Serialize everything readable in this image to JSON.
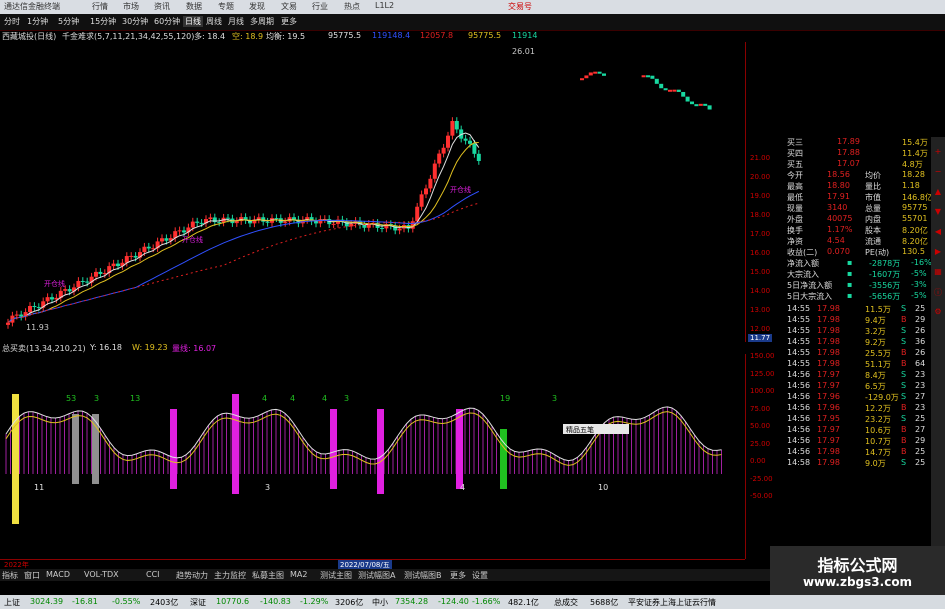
{
  "titlebar": {
    "app_title": "通达信金融终端",
    "menus": [
      "行情",
      "市场",
      "资讯",
      "数据",
      "专题",
      "发现",
      "文易",
      "行业",
      "热点",
      "L1L2"
    ],
    "right_label": "交易号"
  },
  "toolbar": {
    "tabs": [
      "分时",
      "1分钟",
      "5分钟",
      "15分钟",
      "30分钟",
      "60分钟",
      "日线",
      "周线",
      "月线",
      "多周期",
      "更多"
    ]
  },
  "infobar": {
    "stock": "西藏城投(日线)",
    "indicator": "千金难求(5,7,11,21,34,42,55,120)",
    "duo_label": "多: 18.4",
    "kong_label": "空: 18.9",
    "jun_label": "均衡: 19.5",
    "v1": "95775.5",
    "v2": "119148.4",
    "v3": "12057.8",
    "v4": "95775.5",
    "v5": "11914"
  },
  "price_axis": {
    "ticks": [
      "21.00",
      "20.00",
      "19.00",
      "18.00",
      "17.00",
      "16.00",
      "15.00",
      "14.00",
      "13.00",
      "12.00"
    ],
    "current": "11.77"
  },
  "chart_labels": {
    "high": "26.01",
    "low": "11.93",
    "signal1": "开仓线",
    "signal2": "开仓线",
    "signal3": "开仓线"
  },
  "quote": {
    "rows": [
      {
        "label": "买三",
        "price": "17.89",
        "vol": "15.4万"
      },
      {
        "label": "买四",
        "price": "17.88",
        "vol": "11.4万"
      },
      {
        "label": "买五",
        "price": "17.07",
        "vol": "4.8万"
      },
      {
        "label": "今开",
        "price": "18.56",
        "label2": "均价",
        "val2": "18.28"
      },
      {
        "label": "最高",
        "price": "18.80",
        "label2": "量比",
        "val2": "1.18"
      },
      {
        "label": "最低",
        "price": "17.91",
        "label2": "市值",
        "val2": "146.8亿"
      },
      {
        "label": "现量",
        "price": "3140",
        "label2": "总量",
        "val2": "95775"
      },
      {
        "label": "外盘",
        "price": "40075",
        "label2": "内盘",
        "val2": "55701"
      },
      {
        "label": "换手",
        "price": "1.17%",
        "label2": "股本",
        "val2": "8.20亿"
      },
      {
        "label": "净资",
        "price": "4.54",
        "label2": "流通",
        "val2": "8.20亿"
      },
      {
        "label": "收益(二)",
        "price": "0.070",
        "label2": "PE(动)",
        "val2": "130.5"
      }
    ],
    "flows": [
      {
        "label": "净流入额",
        "val": "-2878万",
        "pct": "-16%"
      },
      {
        "label": "大宗流入",
        "val": "-1607万",
        "pct": "-5%"
      },
      {
        "label": "5日净流入额",
        "val": "-3556万",
        "pct": "-3%"
      },
      {
        "label": "5日大宗流入",
        "val": "-5656万",
        "pct": "-5%"
      }
    ],
    "ticks": [
      {
        "t": "14:55",
        "p": "17.98",
        "v": "11.5万",
        "s": "S",
        "n": "25"
      },
      {
        "t": "14:55",
        "p": "17.98",
        "v": "9.4万",
        "s": "B",
        "n": "29"
      },
      {
        "t": "14:55",
        "p": "17.98",
        "v": "3.2万",
        "s": "S",
        "n": "26"
      },
      {
        "t": "14:55",
        "p": "17.98",
        "v": "9.2万",
        "s": "S",
        "n": "36"
      },
      {
        "t": "14:55",
        "p": "17.98",
        "v": "25.5万",
        "s": "B",
        "n": "26"
      },
      {
        "t": "14:55",
        "p": "17.98",
        "v": "51.1万",
        "s": "B",
        "n": "64"
      },
      {
        "t": "14:56",
        "p": "17.97",
        "v": "8.4万",
        "s": "S",
        "n": "23"
      },
      {
        "t": "14:56",
        "p": "17.97",
        "v": "6.5万",
        "s": "S",
        "n": "23"
      },
      {
        "t": "14:56",
        "p": "17.96",
        "v": "-129.0万",
        "s": "S",
        "n": "27"
      },
      {
        "t": "14:56",
        "p": "17.96",
        "v": "12.2万",
        "s": "B",
        "n": "23"
      },
      {
        "t": "14:56",
        "p": "17.95",
        "v": "23.2万",
        "s": "S",
        "n": "25"
      },
      {
        "t": "14:56",
        "p": "17.97",
        "v": "10.6万",
        "s": "B",
        "n": "27"
      },
      {
        "t": "14:56",
        "p": "17.97",
        "v": "10.7万",
        "s": "B",
        "n": "29"
      },
      {
        "t": "14:56",
        "p": "17.98",
        "v": "14.7万",
        "s": "B",
        "n": "25"
      },
      {
        "t": "14:58",
        "p": "17.98",
        "v": "9.0万",
        "s": "S",
        "n": "25"
      }
    ]
  },
  "indicator": {
    "title": "总买卖(13,34,210,21)",
    "y_label": "Y: 16.18",
    "w_label": "W: 19.23",
    "extra": "量线: 16.07",
    "ticks": [
      "150.00",
      "125.00",
      "100.00",
      "75.00",
      "50.00",
      "25.00",
      "0.00",
      "-25.00",
      "-50.00"
    ],
    "nums": [
      "53",
      "3",
      "13",
      "4",
      "4",
      "4",
      "3",
      "19",
      "3"
    ],
    "bottom_nums": [
      "11",
      "3",
      "4",
      "10"
    ]
  },
  "date_strip": {
    "left": "2022年",
    "mid": "2022/07/08/五"
  },
  "bottom_tabs": [
    "指标",
    "窗口",
    "MACD",
    "VOL-TDX",
    "CCI",
    "趋势动力",
    "主力监控",
    "私募主图",
    "MA2",
    "测试主图",
    "测试幅图A",
    "测试幅图B",
    "更多",
    "设置"
  ],
  "status": {
    "sh_label": "上证",
    "sh_val": "3024.39",
    "sh_chg": "-16.81",
    "sh_pct": "-0.55%",
    "sh_amt": "2403亿",
    "sz_label": "深证",
    "sz_val": "10770.6",
    "sz_chg": "-140.83",
    "sz_pct": "-1.29%",
    "sz_amt": "3206亿",
    "zx_label": "中小",
    "zx_val": "7354.28",
    "zx_chg": "-124.40",
    "zx_pct": "-1.66%",
    "zx_amt": "482.1亿",
    "total_label": "总成交",
    "total_val": "5688亿",
    "right": "平安证券上海上证云行情"
  },
  "hotkey": {
    "label": "精品五笔"
  },
  "watermark": {
    "line1": "指标公式网",
    "line2": "www.zbgs3.com"
  },
  "colors": {
    "up": "#ff3030",
    "down": "#18d8a0",
    "ma_white": "#e0e0e0",
    "ma_yellow": "#e0c020",
    "ma_blue": "#3050ff",
    "ma_red_dots": "#e02020",
    "magenta": "#e020e0"
  }
}
